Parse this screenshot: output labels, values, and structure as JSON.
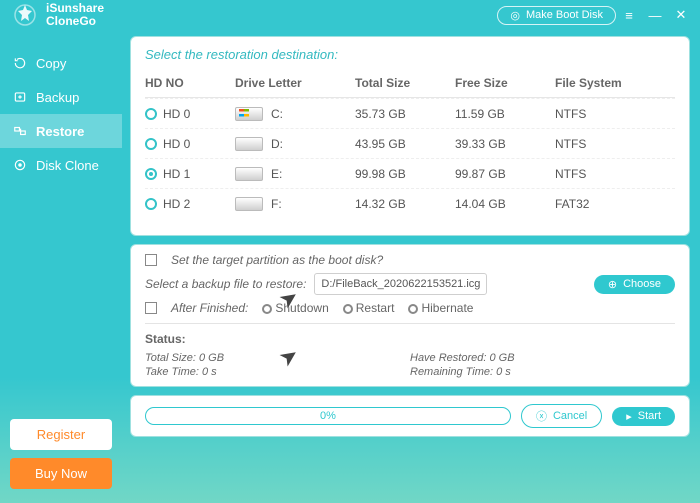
{
  "app": {
    "name_line1": "iSunshare",
    "name_line2": "CloneGo"
  },
  "header": {
    "make_boot": "Make Boot Disk"
  },
  "nav": {
    "items": [
      {
        "label": "Copy"
      },
      {
        "label": "Backup"
      },
      {
        "label": "Restore"
      },
      {
        "label": "Disk Clone"
      }
    ]
  },
  "sidebar_buttons": {
    "register": "Register",
    "buy": "Buy Now"
  },
  "panel_title": "Select the restoration destination:",
  "table": {
    "headers": {
      "hdno": "HD NO",
      "drive": "Drive Letter",
      "total": "Total Size",
      "free": "Free Size",
      "fs": "File System"
    },
    "rows": [
      {
        "hd": "HD 0",
        "letter": "C:",
        "total": "35.73 GB",
        "free": "11.59 GB",
        "fs": "NTFS",
        "win": true,
        "selected": false
      },
      {
        "hd": "HD 0",
        "letter": "D:",
        "total": "43.95 GB",
        "free": "39.33 GB",
        "fs": "NTFS",
        "win": false,
        "selected": false
      },
      {
        "hd": "HD 1",
        "letter": "E:",
        "total": "99.98 GB",
        "free": "99.87 GB",
        "fs": "NTFS",
        "win": false,
        "selected": true
      },
      {
        "hd": "HD 2",
        "letter": "F:",
        "total": "14.32 GB",
        "free": "14.04 GB",
        "fs": "FAT32",
        "win": false,
        "selected": false
      }
    ]
  },
  "options": {
    "boot_label": "Set the target partition as the boot disk?",
    "select_file_label": "Select a backup file to restore:",
    "file_path": "D:/FileBack_2020622153521.icg",
    "choose": "Choose",
    "after_label": "After Finished:",
    "shutdown": "Shutdown",
    "restart": "Restart",
    "hibernate": "Hibernate"
  },
  "status": {
    "heading": "Status:",
    "total": "Total Size: 0 GB",
    "restored": "Have Restored: 0 GB",
    "take": "Take Time: 0 s",
    "remaining": "Remaining Time: 0 s"
  },
  "footer": {
    "progress": "0%",
    "cancel": "Cancel",
    "start": "Start"
  }
}
